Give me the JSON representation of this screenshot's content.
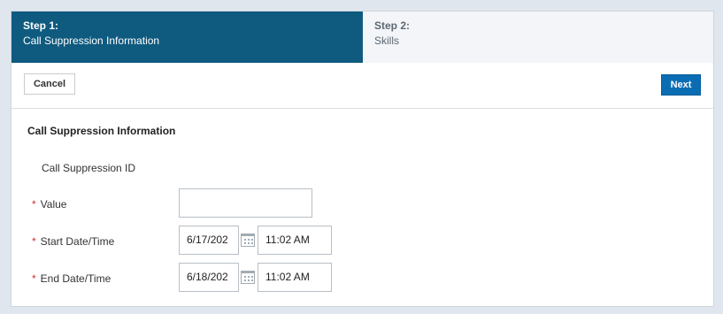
{
  "steps": [
    {
      "number": "Step 1:",
      "title": "Call Suppression Information"
    },
    {
      "number": "Step 2:",
      "title": "Skills"
    }
  ],
  "toolbar": {
    "cancel_label": "Cancel",
    "next_label": "Next"
  },
  "form": {
    "section_title": "Call Suppression Information",
    "id_label": "Call Suppression ID",
    "value_label": "Value",
    "value": "",
    "start_label": "Start Date/Time",
    "start_date": "6/17/202",
    "start_time": "11:02 AM",
    "end_label": "End Date/Time",
    "end_date": "6/18/202",
    "end_time": "11:02 AM",
    "required_marker": "*"
  },
  "colors": {
    "active_step": "#0f5a7f",
    "primary_button": "#0a6db3",
    "required": "#d12f2f"
  }
}
